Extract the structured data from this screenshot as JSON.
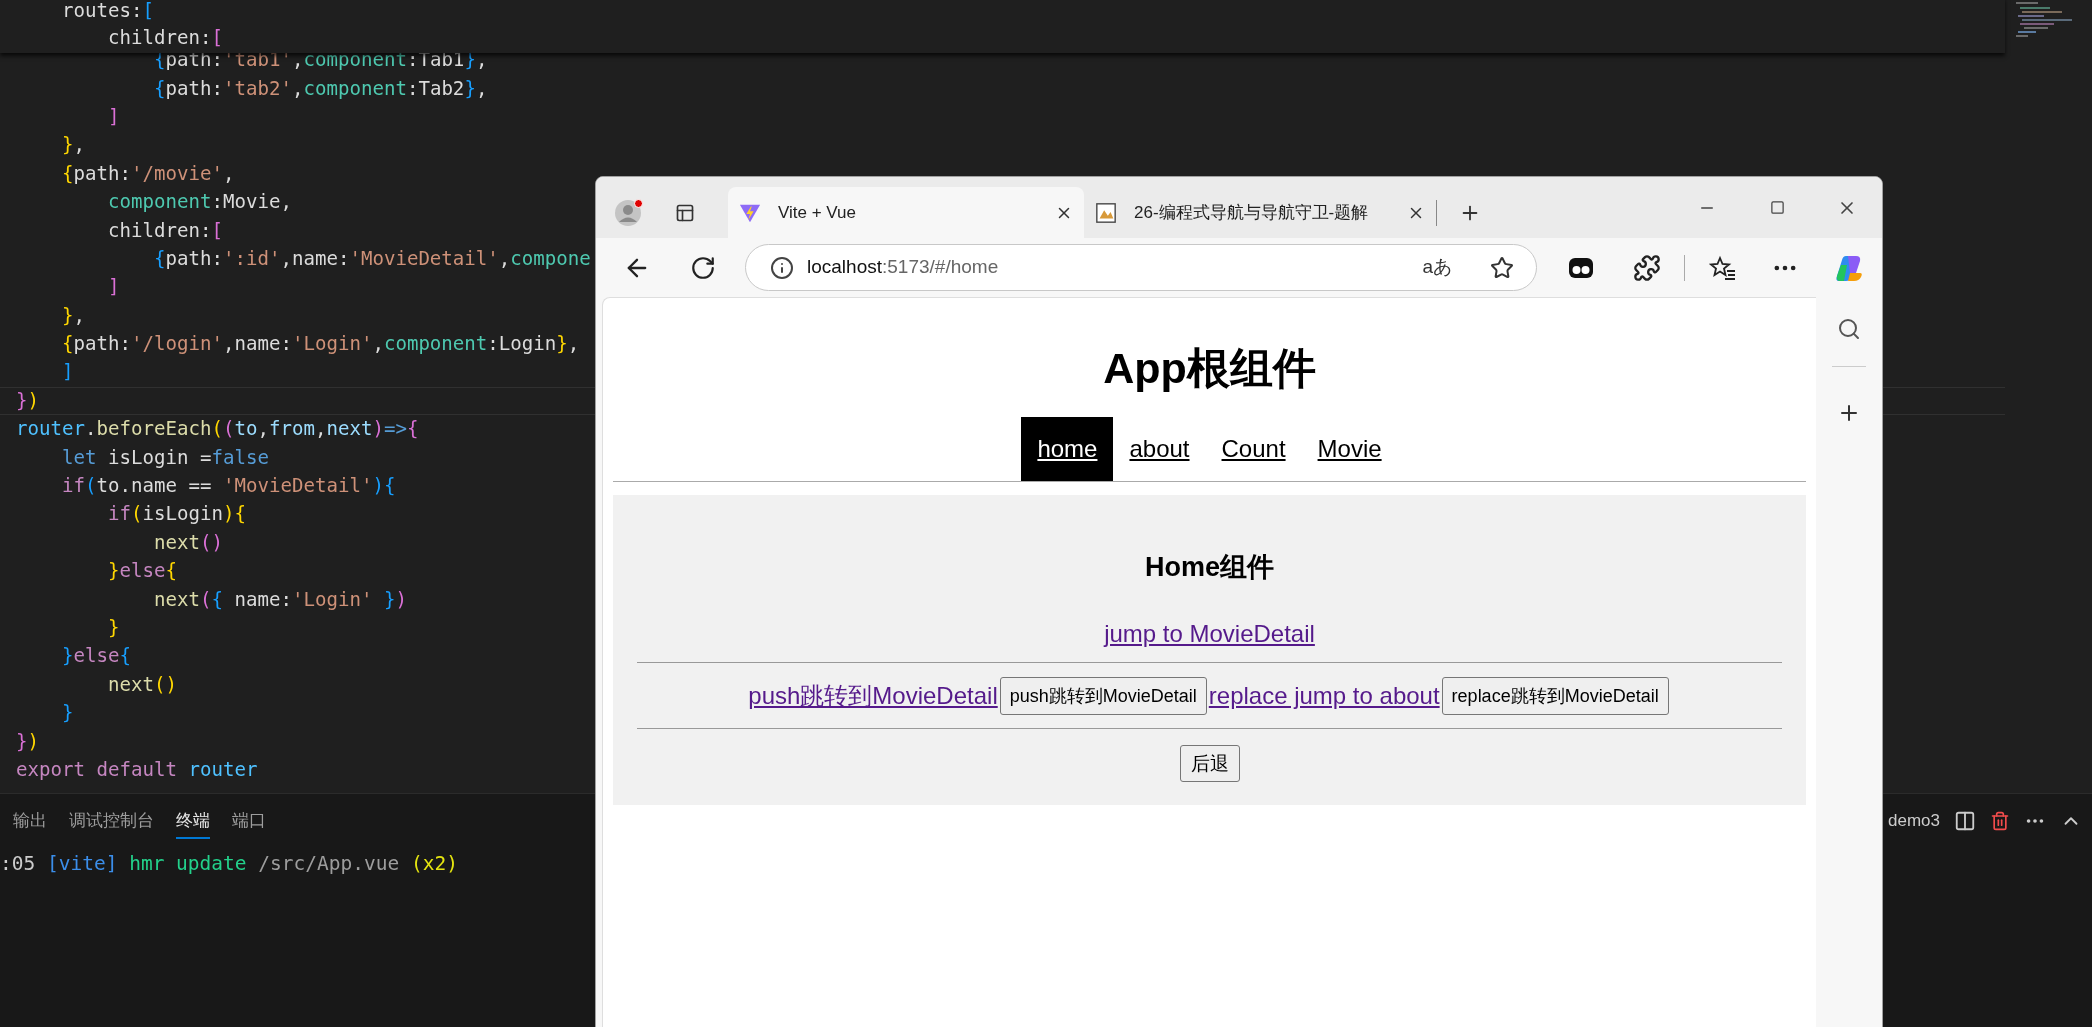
{
  "editor": {
    "sticky_lines": [
      {
        "tokens": [
          {
            "text": "    routes:",
            "color": "#dcdcdc"
          },
          {
            "text": "[",
            "color": "#179fff"
          }
        ]
      },
      {
        "tokens": [
          {
            "text": "        children:",
            "color": "#dcdcdc"
          },
          {
            "text": "[",
            "color": "#da70d6"
          }
        ]
      }
    ],
    "lines": [
      {
        "current": false,
        "tokens": [
          {
            "text": "            {",
            "color": "#179fff"
          },
          {
            "text": "path:",
            "color": "#dcdcdc"
          },
          {
            "text": "'tab1'",
            "color": "#ce9178"
          },
          {
            "text": ",",
            "color": "#dcdcdc"
          },
          {
            "text": "component",
            "color": "#4ec9b0"
          },
          {
            "text": ":Tab1",
            "color": "#dcdcdc"
          },
          {
            "text": "}",
            "color": "#179fff"
          },
          {
            "text": ",",
            "color": "#dcdcdc"
          }
        ]
      },
      {
        "current": false,
        "tokens": [
          {
            "text": "            {",
            "color": "#179fff"
          },
          {
            "text": "path:",
            "color": "#dcdcdc"
          },
          {
            "text": "'tab2'",
            "color": "#ce9178"
          },
          {
            "text": ",",
            "color": "#dcdcdc"
          },
          {
            "text": "component",
            "color": "#4ec9b0"
          },
          {
            "text": ":Tab2",
            "color": "#dcdcdc"
          },
          {
            "text": "}",
            "color": "#179fff"
          },
          {
            "text": ",",
            "color": "#dcdcdc"
          }
        ]
      },
      {
        "current": false,
        "tokens": [
          {
            "text": "        ]",
            "color": "#da70d6"
          }
        ]
      },
      {
        "current": false,
        "tokens": [
          {
            "text": "    }",
            "color": "#ffd700"
          },
          {
            "text": ",",
            "color": "#dcdcdc"
          }
        ]
      },
      {
        "current": false,
        "tokens": [
          {
            "text": "    {",
            "color": "#ffd700"
          },
          {
            "text": "path:",
            "color": "#dcdcdc"
          },
          {
            "text": "'/movie'",
            "color": "#ce9178"
          },
          {
            "text": ",",
            "color": "#dcdcdc"
          }
        ]
      },
      {
        "current": false,
        "tokens": [
          {
            "text": "        component",
            "color": "#4ec9b0"
          },
          {
            "text": ":Movie,",
            "color": "#dcdcdc"
          }
        ]
      },
      {
        "current": false,
        "tokens": [
          {
            "text": "        children:",
            "color": "#dcdcdc"
          },
          {
            "text": "[",
            "color": "#da70d6"
          }
        ]
      },
      {
        "current": false,
        "tokens": [
          {
            "text": "            {",
            "color": "#179fff"
          },
          {
            "text": "path:",
            "color": "#dcdcdc"
          },
          {
            "text": "':id'",
            "color": "#ce9178"
          },
          {
            "text": ",name:",
            "color": "#dcdcdc"
          },
          {
            "text": "'MovieDetail'",
            "color": "#ce9178"
          },
          {
            "text": ",",
            "color": "#dcdcdc"
          },
          {
            "text": "compone",
            "color": "#4ec9b0"
          }
        ]
      },
      {
        "current": false,
        "tokens": [
          {
            "text": "        ]",
            "color": "#da70d6"
          }
        ]
      },
      {
        "current": false,
        "tokens": [
          {
            "text": "    }",
            "color": "#ffd700"
          },
          {
            "text": ",",
            "color": "#dcdcdc"
          }
        ]
      },
      {
        "current": false,
        "tokens": [
          {
            "text": "    {",
            "color": "#ffd700"
          },
          {
            "text": "path:",
            "color": "#dcdcdc"
          },
          {
            "text": "'/login'",
            "color": "#ce9178"
          },
          {
            "text": ",name:",
            "color": "#dcdcdc"
          },
          {
            "text": "'Login'",
            "color": "#ce9178"
          },
          {
            "text": ",",
            "color": "#dcdcdc"
          },
          {
            "text": "component",
            "color": "#4ec9b0"
          },
          {
            "text": ":Login",
            "color": "#dcdcdc"
          },
          {
            "text": "}",
            "color": "#ffd700"
          },
          {
            "text": ",",
            "color": "#dcdcdc"
          }
        ]
      },
      {
        "current": false,
        "tokens": [
          {
            "text": "    ]",
            "color": "#179fff"
          }
        ]
      },
      {
        "current": true,
        "tokens": [
          {
            "text": "}",
            "color": "#da70d6"
          },
          {
            "text": ")",
            "color": "#ffd700"
          }
        ]
      },
      {
        "current": false,
        "tokens": [
          {
            "text": "router",
            "color": "#4fc1ff"
          },
          {
            "text": ".",
            "color": "#dcdcdc"
          },
          {
            "text": "beforeEach",
            "color": "#dcdcaa"
          },
          {
            "text": "(",
            "color": "#ffd700"
          },
          {
            "text": "(",
            "color": "#da70d6"
          },
          {
            "text": "to",
            "color": "#9cdcfe"
          },
          {
            "text": ",",
            "color": "#dcdcdc"
          },
          {
            "text": "from",
            "color": "#9cdcfe"
          },
          {
            "text": ",",
            "color": "#dcdcdc"
          },
          {
            "text": "next",
            "color": "#9cdcfe"
          },
          {
            "text": ")",
            "color": "#da70d6"
          },
          {
            "text": "=>",
            "color": "#569cd6"
          },
          {
            "text": "{",
            "color": "#da70d6"
          }
        ]
      },
      {
        "current": false,
        "tokens": [
          {
            "text": "    let",
            "color": "#569cd6"
          },
          {
            "text": " isLogin =",
            "color": "#dcdcdc"
          },
          {
            "text": "false",
            "color": "#569cd6"
          }
        ]
      },
      {
        "current": false,
        "tokens": [
          {
            "text": "    if",
            "color": "#c586c0"
          },
          {
            "text": "(",
            "color": "#179fff"
          },
          {
            "text": "to.name == ",
            "color": "#dcdcdc"
          },
          {
            "text": "'MovieDetail'",
            "color": "#ce9178"
          },
          {
            "text": ")",
            "color": "#179fff"
          },
          {
            "text": "{",
            "color": "#179fff"
          }
        ]
      },
      {
        "current": false,
        "tokens": [
          {
            "text": "        if",
            "color": "#c586c0"
          },
          {
            "text": "(",
            "color": "#ffd700"
          },
          {
            "text": "isLogin",
            "color": "#dcdcdc"
          },
          {
            "text": ")",
            "color": "#ffd700"
          },
          {
            "text": "{",
            "color": "#ffd700"
          }
        ]
      },
      {
        "current": false,
        "tokens": [
          {
            "text": "            next",
            "color": "#dcdcaa"
          },
          {
            "text": "()",
            "color": "#da70d6"
          }
        ]
      },
      {
        "current": false,
        "tokens": [
          {
            "text": "        }",
            "color": "#ffd700"
          },
          {
            "text": "else",
            "color": "#c586c0"
          },
          {
            "text": "{",
            "color": "#ffd700"
          }
        ]
      },
      {
        "current": false,
        "tokens": [
          {
            "text": "            next",
            "color": "#dcdcaa"
          },
          {
            "text": "(",
            "color": "#da70d6"
          },
          {
            "text": "{",
            "color": "#179fff"
          },
          {
            "text": " name:",
            "color": "#dcdcdc"
          },
          {
            "text": "'Login'",
            "color": "#ce9178"
          },
          {
            "text": " }",
            "color": "#179fff"
          },
          {
            "text": ")",
            "color": "#da70d6"
          }
        ]
      },
      {
        "current": false,
        "tokens": [
          {
            "text": "        }",
            "color": "#ffd700"
          }
        ]
      },
      {
        "current": false,
        "tokens": [
          {
            "text": "    }",
            "color": "#179fff"
          },
          {
            "text": "else",
            "color": "#c586c0"
          },
          {
            "text": "{",
            "color": "#179fff"
          }
        ]
      },
      {
        "current": false,
        "tokens": [
          {
            "text": "        next",
            "color": "#dcdcaa"
          },
          {
            "text": "()",
            "color": "#ffd700"
          }
        ]
      },
      {
        "current": false,
        "tokens": [
          {
            "text": "    }",
            "color": "#179fff"
          }
        ]
      },
      {
        "current": false,
        "tokens": [
          {
            "text": "}",
            "color": "#da70d6"
          },
          {
            "text": ")",
            "color": "#ffd700"
          }
        ]
      },
      {
        "current": false,
        "tokens": [
          {
            "text": "export default",
            "color": "#c586c0"
          },
          {
            "text": " router",
            "color": "#4fc1ff"
          }
        ]
      }
    ]
  },
  "panel": {
    "tabs": [
      {
        "label": "输出",
        "selected": false
      },
      {
        "label": "调试控制台",
        "selected": false
      },
      {
        "label": "终端",
        "selected": true
      },
      {
        "label": "端口",
        "selected": false
      }
    ],
    "terminal_name": "demo3",
    "terminal_lines": [
      {
        "tokens": [
          {
            "text": ":05 ",
            "color": "#cccccc"
          },
          {
            "text": "[vite]",
            "color": "#3b8eea"
          },
          {
            "text": " hmr update",
            "color": "#23d18b"
          },
          {
            "text": " /src/App.vue",
            "color": "#9d9d9d"
          },
          {
            "text": " (x2)",
            "color": "#e5e510"
          }
        ]
      }
    ]
  },
  "browser": {
    "tabs": [
      {
        "title": "Vite + Vue",
        "selected": true,
        "kind": "vite"
      },
      {
        "title": "26-编程式导航与导航守卫-题解",
        "selected": false,
        "kind": "document"
      }
    ],
    "address": {
      "host": "localhost",
      "rest": ":5173/#/home",
      "read_aloud": "aあ"
    },
    "page": {
      "title": "App根组件",
      "nav": [
        {
          "label": "home",
          "selected": true
        },
        {
          "label": "about",
          "selected": false
        },
        {
          "label": "Count",
          "selected": false
        },
        {
          "label": "Movie",
          "selected": false
        }
      ],
      "home": {
        "heading": "Home组件",
        "link": "jump to MovieDetail",
        "actions": [
          {
            "kind": "link",
            "label": "push跳转到MovieDetail"
          },
          {
            "kind": "button",
            "label": "push跳转到MovieDetail"
          },
          {
            "kind": "link",
            "label": "replace jump to about"
          },
          {
            "kind": "button",
            "label": "replace跳转到MovieDetail"
          }
        ],
        "back_button": "后退"
      }
    }
  }
}
